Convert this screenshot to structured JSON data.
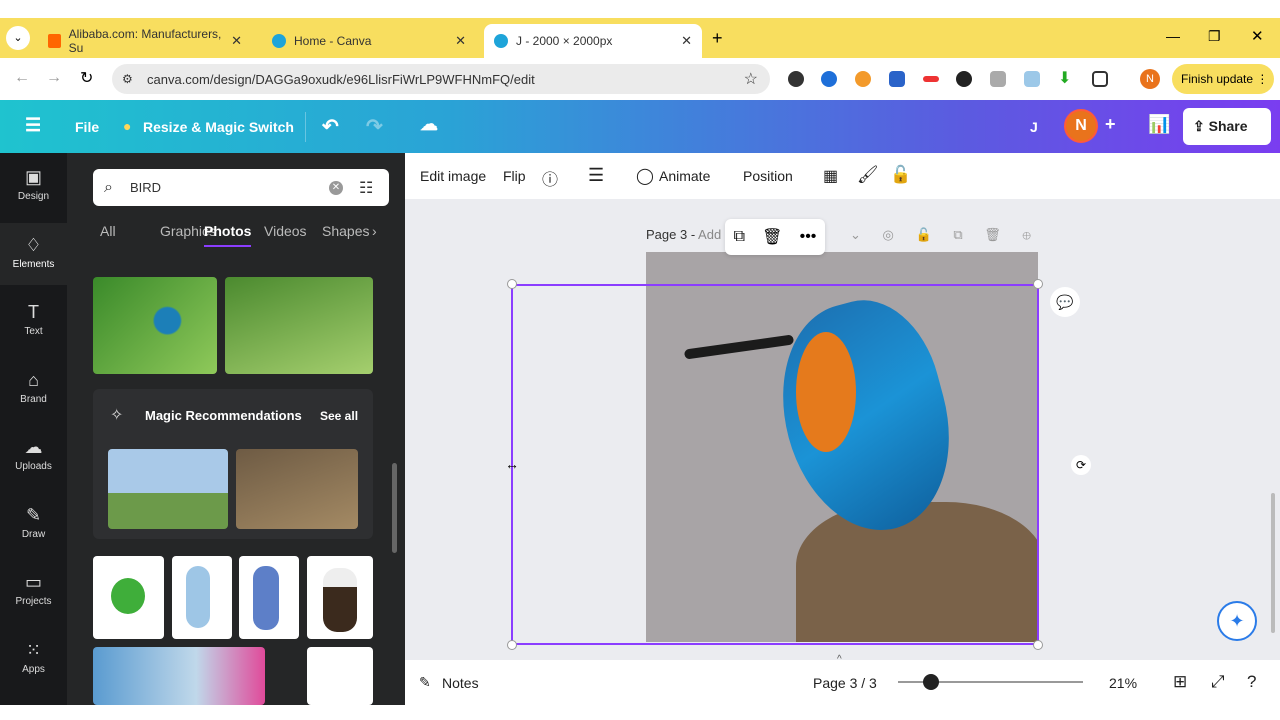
{
  "browser": {
    "tabs": [
      {
        "title": "Alibaba.com: Manufacturers, Su"
      },
      {
        "title": "Home - Canva"
      },
      {
        "title": "J - 2000 × 2000px"
      }
    ],
    "url": "canva.com/design/DAGGa9oxudk/e96LlisrFiWrLP9WFHNmFQ/edit",
    "profile": "N",
    "finish_update": "Finish update"
  },
  "header": {
    "file": "File",
    "resize": "Resize & Magic Switch",
    "user_initial": "J",
    "avatar": "N",
    "share": "Share"
  },
  "rail": [
    {
      "label": "Design"
    },
    {
      "label": "Elements"
    },
    {
      "label": "Text"
    },
    {
      "label": "Brand"
    },
    {
      "label": "Uploads"
    },
    {
      "label": "Draw"
    },
    {
      "label": "Projects"
    },
    {
      "label": "Apps"
    }
  ],
  "panel": {
    "search_value": "BIRD",
    "tabs": [
      "All",
      "Graphics",
      "Photos",
      "Videos",
      "Shapes"
    ],
    "magic_title": "Magic Recommendations",
    "see_all": "See all"
  },
  "toolbar": {
    "edit_image": "Edit image",
    "flip": "Flip",
    "animate": "Animate",
    "position": "Position"
  },
  "page": {
    "label": "Page 3 - ",
    "add_title": "Add"
  },
  "bottom": {
    "notes": "Notes",
    "page_indicator": "Page 3 / 3",
    "zoom": "21%",
    "zoom_fraction": 0.18
  }
}
